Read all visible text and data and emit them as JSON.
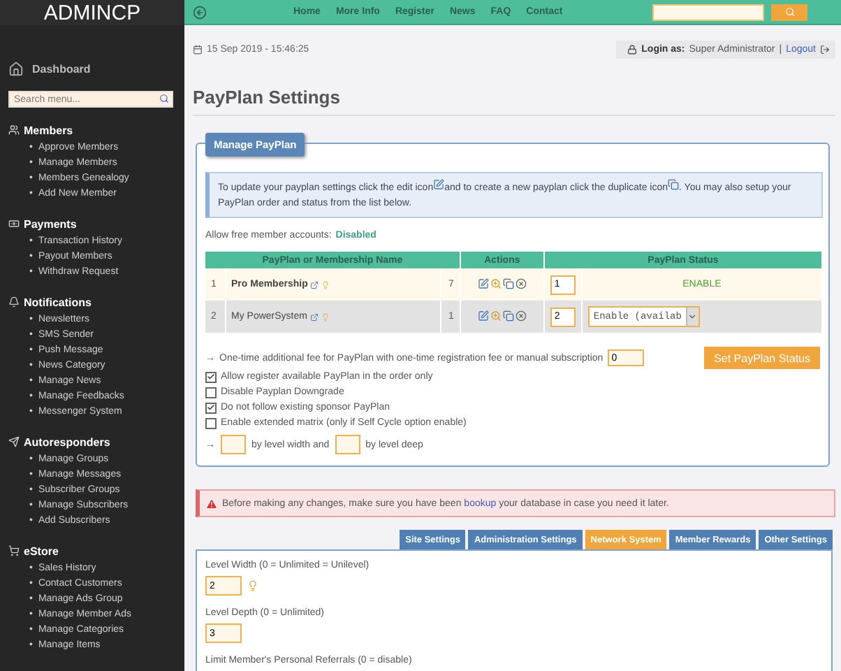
{
  "brand": "ADMINCP",
  "nav": {
    "links": [
      "Home",
      "More Info",
      "Register",
      "News",
      "FAQ",
      "Contact"
    ]
  },
  "sidebar": {
    "bullet": "•",
    "dashboard": "Dashboard",
    "search_placeholder": "Search menu...",
    "sections": [
      {
        "kind": "members",
        "title": "Members",
        "items": [
          "Approve Members",
          "Manage Members",
          "Members Genealogy",
          "Add New Member"
        ]
      },
      {
        "kind": "payments",
        "title": "Payments",
        "items": [
          "Transaction History",
          "Payout Members",
          "Withdraw Request"
        ]
      },
      {
        "kind": "notifications",
        "title": "Notifications",
        "items": [
          "Newsletters",
          "SMS Sender",
          "Push Message",
          "News Category",
          "Manage News",
          "Manage Feedbacks",
          "Messenger System"
        ]
      },
      {
        "kind": "autoresponders",
        "title": "Autoresponders",
        "items": [
          "Manage Groups",
          "Manage Messages",
          "Subscriber Groups",
          "Manage Subscribers",
          "Add Subscribers"
        ]
      },
      {
        "kind": "estore",
        "title": "eStore",
        "items": [
          "Sales History",
          "Contact Customers",
          "Manage Ads Group",
          "Manage Member Ads",
          "Manage Categories",
          "Manage Items"
        ]
      }
    ]
  },
  "datetime": "15 Sep 2019 - 15:46:25",
  "login": {
    "label": "Login as:",
    "user": "Super Administrator",
    "separator": "|",
    "logout": "Logout"
  },
  "page_title": "PayPlan Settings",
  "manage": {
    "legend": "Manage PayPlan",
    "info": [
      "To update your payplan settings click the edit icon",
      "and to create a new payplan click the duplicate icon",
      ". You may also setup your",
      "PayPlan order and status from the list below."
    ],
    "free_accounts": {
      "label": "Allow free member accounts:",
      "value": "Disabled"
    },
    "table": {
      "columns": [
        "PayPlan or Membership Name",
        "Actions",
        "PayPlan Status"
      ],
      "rows": [
        {
          "index": "1",
          "name": "Pro Membership",
          "default": true,
          "count": "7",
          "order": "1",
          "kind": "label",
          "status": "ENABLE"
        },
        {
          "index": "2",
          "name": "My PowerSystem",
          "default": false,
          "count": "1",
          "order": "2",
          "kind": "select",
          "status": "Enable (availab"
        }
      ]
    },
    "fee": {
      "arrow": "→",
      "text": "One-time additional fee for PayPlan with one-time registration fee or manual subscription",
      "value": "0"
    },
    "submit": "Set PayPlan Status",
    "options": [
      {
        "label": "Allow register available PayPlan in the order only",
        "checked": true
      },
      {
        "label": "Disable Payplan Downgrade",
        "checked": false
      },
      {
        "label": "Do not follow existing sponsor PayPlan",
        "checked": true
      },
      {
        "label": "Enable extended matrix (only if Self Cycle option enable)",
        "checked": false
      }
    ],
    "matrix": {
      "arrow": "→",
      "width_text": "by level width and",
      "depth_text": "by level deep"
    }
  },
  "alert": {
    "before": "Before making any changes, make sure you have been",
    "link": "bookup",
    "after": "your database in case you need it later."
  },
  "tabs": [
    {
      "label": "Site Settings",
      "selected": false
    },
    {
      "label": "Administration Settings",
      "selected": false
    },
    {
      "label": "Network System",
      "selected": true
    },
    {
      "label": "Member Rewards",
      "selected": false
    },
    {
      "label": "Other Settings",
      "selected": false
    }
  ],
  "fields": [
    {
      "label": "Level Width (0 = Unlimited = Unilevel)",
      "value": "2",
      "hint": true
    },
    {
      "label": "Level Depth (0 = Unlimited)",
      "value": "3",
      "hint": false
    },
    {
      "label": "Limit Member's Personal Referrals (0 = disable)"
    }
  ]
}
